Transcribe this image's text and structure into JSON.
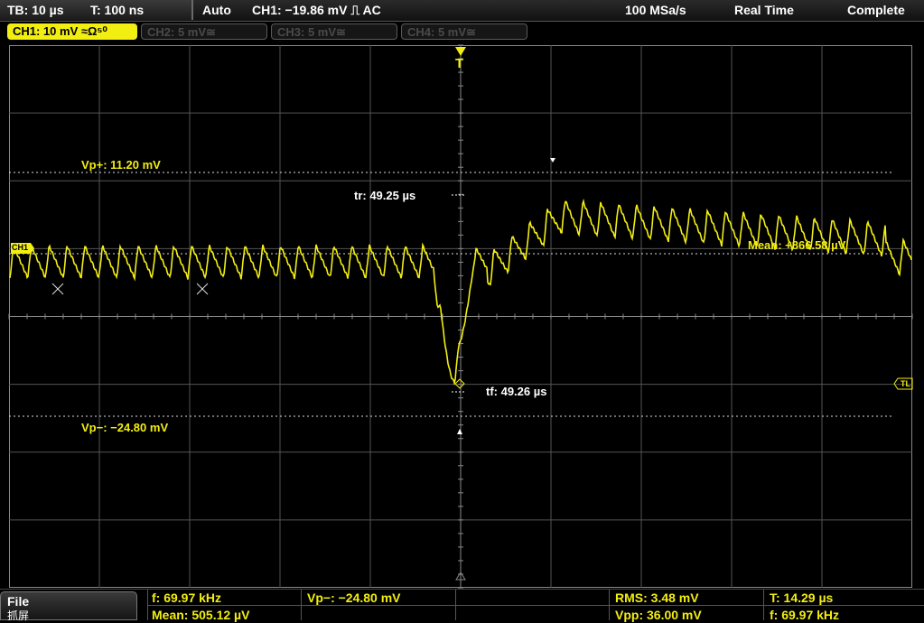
{
  "topbar": {
    "tb": "TB: 10 µs",
    "t": "T: 100 ns",
    "mode": "Auto",
    "trigger": "CH1: −19.86 mV ⎍ AC",
    "sample_rate": "100 MSa/s",
    "acq_mode": "Real Time",
    "status": "Complete"
  },
  "channels": [
    {
      "label": "CH1: 10 mV ≈Ω⁵⁰",
      "active": true
    },
    {
      "label": "CH2: 5 mV≅",
      "active": false
    },
    {
      "label": "CH3: 5 mV≅",
      "active": false
    },
    {
      "label": "CH4: 5 mV≅",
      "active": false
    }
  ],
  "markers": {
    "trigger": "T",
    "ch1": "CH1",
    "tl": "TL"
  },
  "cursors": {
    "vp_plus": "Vp+: 11.20 mV",
    "vp_minus": "Vp−: −24.80 mV",
    "tr": "tr: 49.25 µs",
    "tf": "tf: 49.26 µs",
    "mean": "Mean: +866.58 µV"
  },
  "file": {
    "label": "File",
    "sub": "抓屏"
  },
  "measurements": {
    "f1": "f: 69.97 kHz",
    "mean": "Mean: 505.12 µV",
    "vpm": "Vp−: −24.80 mV",
    "rms": "RMS: 3.48 mV",
    "vpp": "Vpp: 36.00 mV",
    "t": "T: 14.29 µs",
    "f2": "f: 69.97 kHz"
  },
  "colors": {
    "trace": "#f2ee12",
    "grid": "#8a8a8a",
    "background": "#000000"
  }
}
